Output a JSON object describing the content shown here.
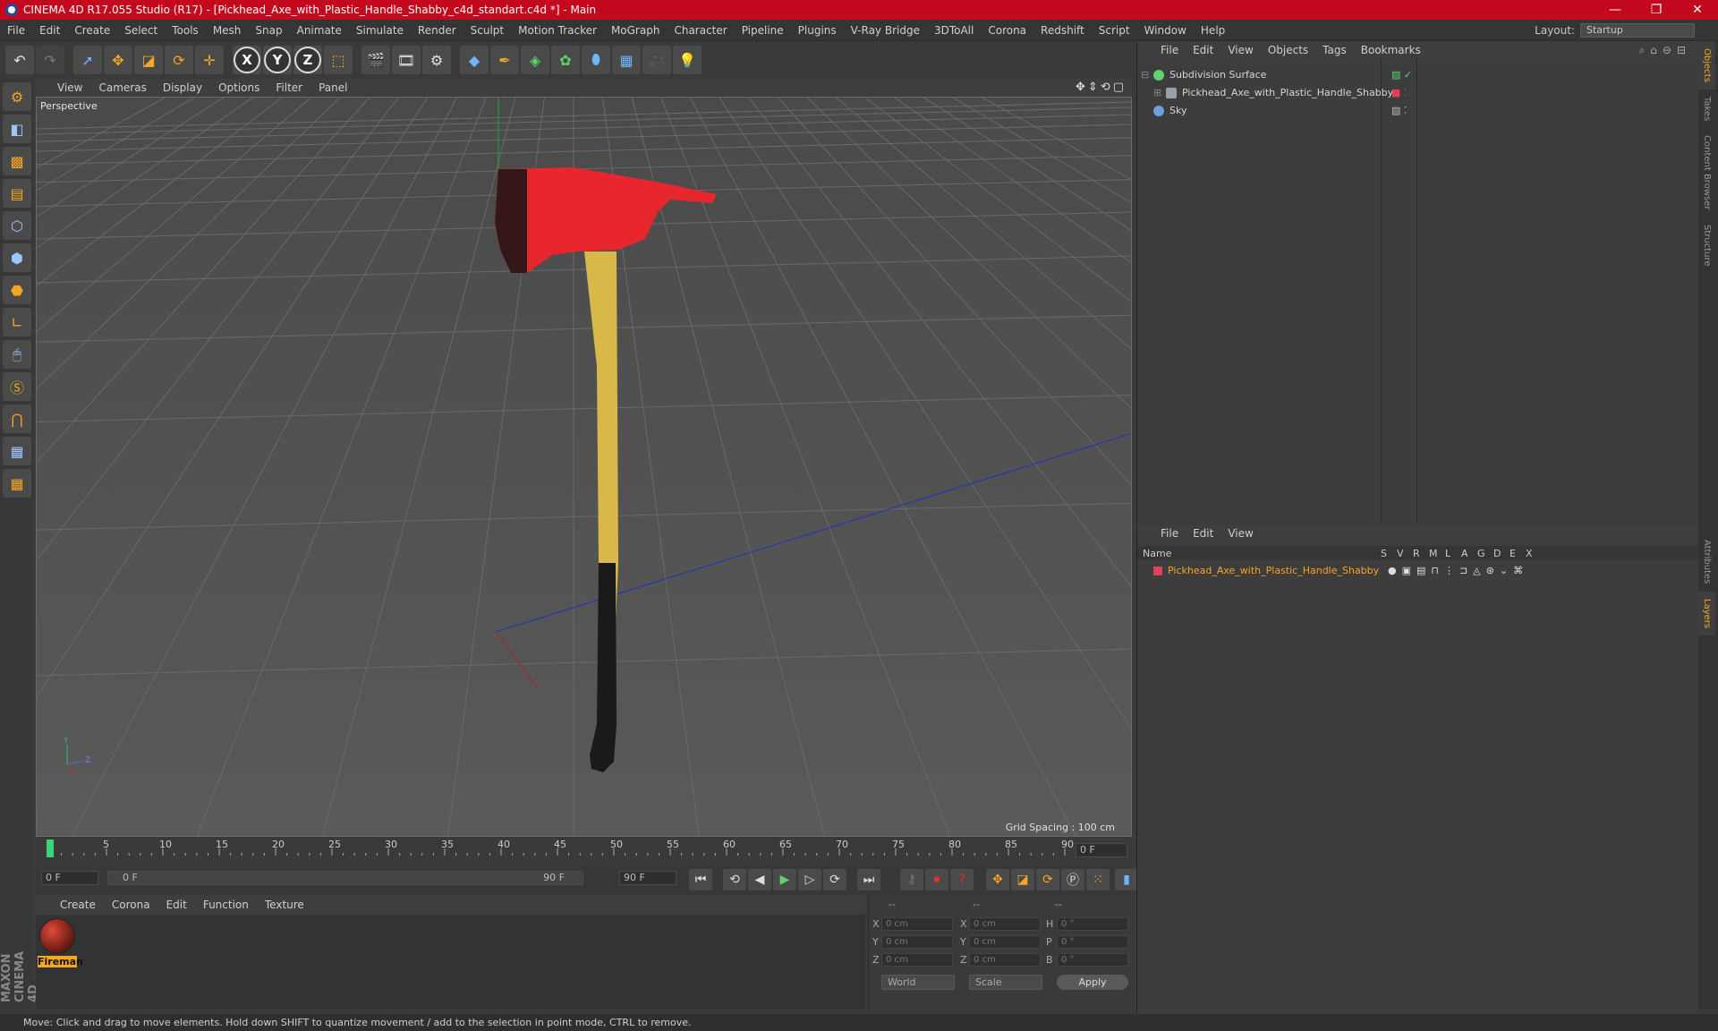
{
  "window": {
    "title": "CINEMA 4D R17.055 Studio (R17) - [Pickhead_Axe_with_Plastic_Handle_Shabby_c4d_standart.c4d *] - Main",
    "controls": [
      "—",
      "❐",
      "✕"
    ]
  },
  "menubar": {
    "items": [
      "File",
      "Edit",
      "Create",
      "Select",
      "Tools",
      "Mesh",
      "Snap",
      "Animate",
      "Simulate",
      "Render",
      "Sculpt",
      "Motion Tracker",
      "MoGraph",
      "Character",
      "Pipeline",
      "Plugins",
      "V-Ray Bridge",
      "3DToAll",
      "Corona",
      "Redshift",
      "Script",
      "Window",
      "Help"
    ],
    "layout_label": "Layout:",
    "layout_value": "Startup"
  },
  "toolbar": {
    "xyz": [
      "X",
      "Y",
      "Z"
    ]
  },
  "viewport": {
    "menu": [
      "View",
      "Cameras",
      "Display",
      "Options",
      "Filter",
      "Panel"
    ],
    "label": "Perspective",
    "grid_spacing": "Grid Spacing : 100 cm",
    "axis_labels": [
      "Y",
      "Z",
      "X"
    ],
    "colors": {
      "axe_head": "#e8262e",
      "handle": "#d9b84a",
      "grip": "#1a1a1a",
      "x_axis": "#b02020",
      "y_axis": "#20a040",
      "z_axis": "#2030c0"
    }
  },
  "timeline": {
    "ticks": [
      "0",
      "5",
      "10",
      "15",
      "20",
      "25",
      "30",
      "35",
      "40",
      "45",
      "50",
      "55",
      "60",
      "65",
      "70",
      "75",
      "80",
      "85",
      "90"
    ],
    "current_frame": "0 F",
    "start_field": "0 F",
    "range_start": "0 F",
    "range_end": "90 F",
    "end_field": "90 F"
  },
  "material_manager": {
    "menu": [
      "Create",
      "Corona",
      "Edit",
      "Function",
      "Texture"
    ],
    "materials": [
      {
        "name": "Fireman"
      }
    ]
  },
  "coordinates": {
    "headers": [
      "--",
      "--",
      "--"
    ],
    "rows": [
      {
        "axis": "X",
        "pos": "0 cm",
        "saxis": "X",
        "size": "0 cm",
        "raxis": "H",
        "rot": "0 °"
      },
      {
        "axis": "Y",
        "pos": "0 cm",
        "saxis": "Y",
        "size": "0 cm",
        "raxis": "P",
        "rot": "0 °"
      },
      {
        "axis": "Z",
        "pos": "0 cm",
        "saxis": "Z",
        "size": "0 cm",
        "raxis": "B",
        "rot": "0 °"
      }
    ],
    "mode": "World",
    "scale": "Scale",
    "apply": "Apply"
  },
  "object_manager": {
    "menu": [
      "File",
      "Edit",
      "View",
      "Objects",
      "Tags",
      "Bookmarks"
    ],
    "objects": [
      {
        "name": "Subdivision Surface",
        "color": "#5dd36a"
      },
      {
        "name": "Pickhead_Axe_with_Plastic_Handle_Shabby",
        "color": "#9aa0aa"
      },
      {
        "name": "Sky",
        "color": "#6aa0e0"
      }
    ]
  },
  "layer_manager": {
    "menu": [
      "File",
      "Edit",
      "View"
    ],
    "columns": [
      "Name",
      "S",
      "V",
      "R",
      "M",
      "L",
      "A",
      "G",
      "D",
      "E",
      "X"
    ],
    "layers": [
      {
        "name": "Pickhead_Axe_with_Plastic_Handle_Shabby",
        "color": "#e0405a"
      }
    ]
  },
  "side_tabs": [
    "Objects",
    "Takes",
    "Content Browser",
    "Structure",
    "Attributes",
    "Layers"
  ],
  "brand": "MAXON CINEMA 4D",
  "status": "Move: Click and drag to move elements. Hold down SHIFT to quantize movement / add to the selection in point mode, CTRL to remove."
}
